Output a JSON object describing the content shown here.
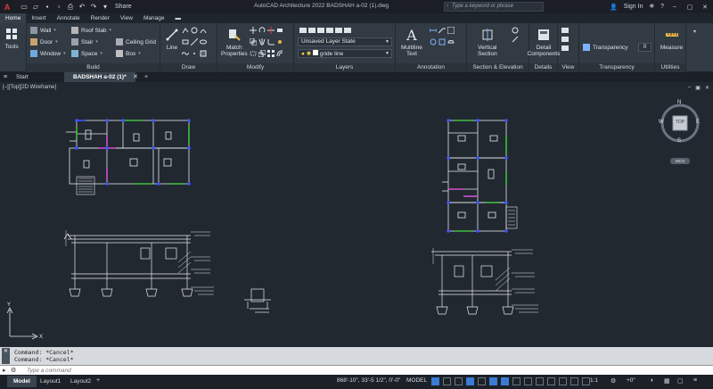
{
  "app": {
    "title": "AutoCAD Architecture 2022    BADSHAH a-02 (1).dwg",
    "search_placeholder": "Type a keyword or phrase",
    "share_label": "Share",
    "signin_label": "Sign In"
  },
  "ribbon_tabs": [
    "Home",
    "Insert",
    "Annotate",
    "Render",
    "View",
    "Manage"
  ],
  "ribbon": {
    "tools": {
      "label": "Tools"
    },
    "build": {
      "title": "Build",
      "items": [
        "Wall",
        "Door",
        "Window",
        "Roof Slab",
        "Stair",
        "Space",
        "Ceiling Grid",
        "Box"
      ]
    },
    "draw": {
      "title": "Draw",
      "line_label": "Line"
    },
    "modify": {
      "title": "Modify",
      "match_label": "Match\nProperties"
    },
    "layers": {
      "title": "Layers",
      "layer_state": "Unsaved Layer State",
      "current_layer": "gride line"
    },
    "annotation": {
      "title": "Annotation",
      "mtext_label": "Multiline\nText"
    },
    "section": {
      "title": "Section & Elevation",
      "vertical_label": "Vertical\nSection"
    },
    "details": {
      "title": "Details",
      "detail_label": "Detail\nComponents"
    },
    "view": {
      "title": "View"
    },
    "transparency": {
      "title": "Transparency",
      "label": "Transparency",
      "value": "0"
    },
    "utilities": {
      "title": "Utilities",
      "measure_label": "Measure"
    }
  },
  "file_tabs": {
    "start": "Start",
    "active": "BADSHAH a-02 (1)*"
  },
  "viewport": {
    "label": "[–][Top][2D Wireframe]",
    "viewcube_face": "TOP",
    "compass": {
      "n": "N",
      "s": "S",
      "e": "E",
      "w": "W"
    },
    "wcs": "WCS"
  },
  "command": {
    "history": [
      "Command: *Cancel*",
      "Command: *Cancel*"
    ],
    "placeholder": "Type a command"
  },
  "status": {
    "layout_tabs": [
      "Model",
      "Layout1",
      "Layout2"
    ],
    "coords": "868'-10\",  33'-5 1/2\",  0'-0\"",
    "mode": "MODEL",
    "scale": "1:1",
    "zoom": "+0\""
  },
  "colors": {
    "accent": "#3a7bd5",
    "background": "#212830",
    "wall_blue": "#3a56ff",
    "wall_green": "#3fbf3f",
    "wall_magenta": "#d050d0"
  }
}
